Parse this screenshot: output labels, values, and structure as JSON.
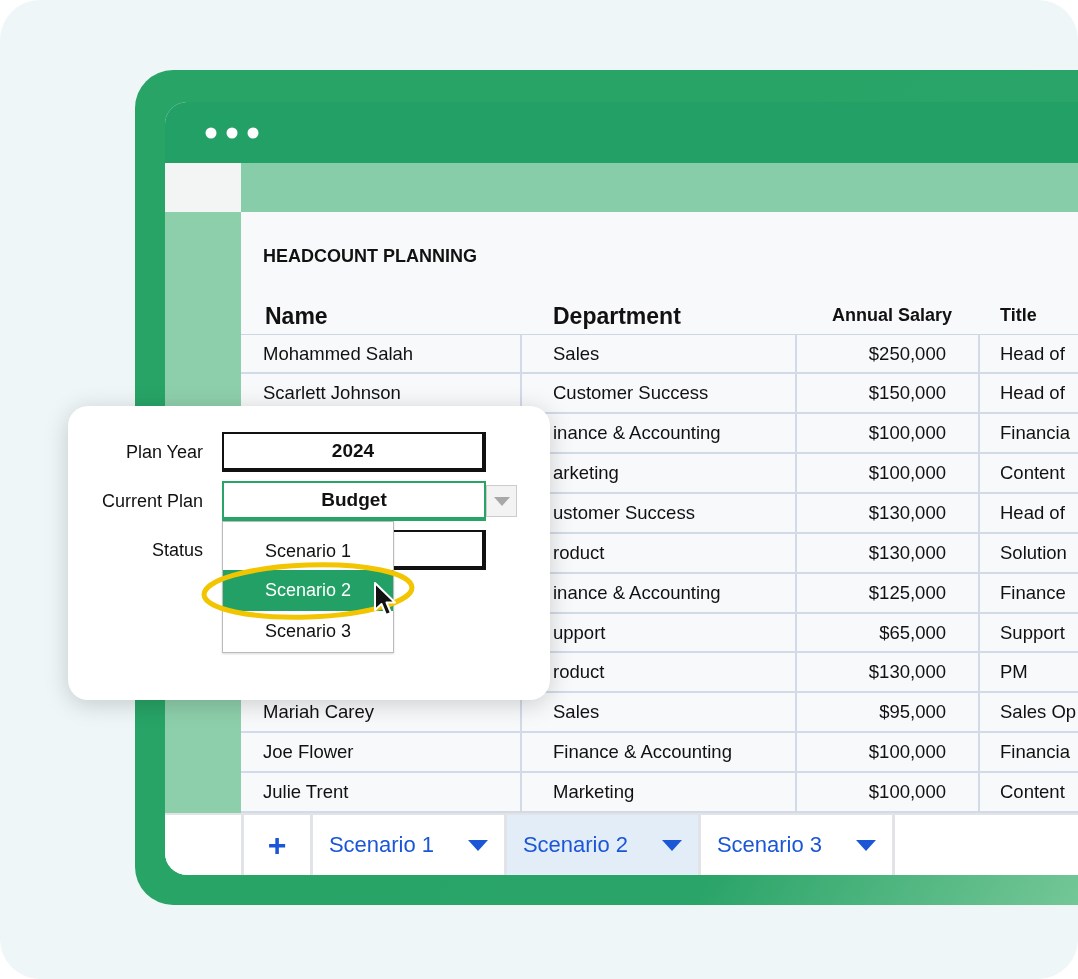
{
  "sheet": {
    "title": "HEADCOUNT PLANNING",
    "columns": [
      {
        "label": "Name"
      },
      {
        "label": "Department"
      },
      {
        "label": "Annual Salary"
      },
      {
        "label": "Title"
      }
    ],
    "rows": [
      {
        "name": "Mohammed Salah",
        "department": "Sales",
        "salary": "$250,000",
        "title": "Head of"
      },
      {
        "name": "Scarlett Johnson",
        "department": "Customer Success",
        "salary": "$150,000",
        "title": "Head of"
      },
      {
        "department": "inance & Accounting",
        "salary": "$100,000",
        "title": "Financia"
      },
      {
        "department": "arketing",
        "salary": "$100,000",
        "title": "Content"
      },
      {
        "department": "ustomer Success",
        "salary": "$130,000",
        "title": "Head of"
      },
      {
        "department": "roduct",
        "salary": "$130,000",
        "title": "Solution"
      },
      {
        "department": "inance & Accounting",
        "salary": "$125,000",
        "title": "Finance"
      },
      {
        "department": "upport",
        "salary": "$65,000",
        "title": "Support"
      },
      {
        "department": "roduct",
        "salary": "$130,000",
        "title": "PM"
      },
      {
        "name": "Mariah Carey",
        "department": "Sales",
        "salary": "$95,000",
        "title": "Sales Op"
      },
      {
        "name": "Joe Flower",
        "department": "Finance & Accounting",
        "salary": "$100,000",
        "title": "Financia"
      },
      {
        "name": "Julie Trent",
        "department": "Marketing",
        "salary": "$100,000",
        "title": "Content"
      }
    ]
  },
  "tabs": {
    "add": "+",
    "items": [
      {
        "label": "Scenario 1",
        "selected": false
      },
      {
        "label": "Scenario 2",
        "selected": true
      },
      {
        "label": "Scenario 3",
        "selected": false
      }
    ]
  },
  "popup": {
    "fields": [
      {
        "label": "Plan Year",
        "kind": "text",
        "value": "2024"
      },
      {
        "label": "Current Plan",
        "kind": "select",
        "value": "Budget"
      },
      {
        "label": "Status",
        "kind": "text"
      }
    ],
    "dropdown": {
      "options": [
        {
          "label": "Scenario 1",
          "selected": false
        },
        {
          "label": "Scenario 2",
          "selected": true
        },
        {
          "label": "Scenario 3",
          "selected": false
        }
      ]
    }
  }
}
